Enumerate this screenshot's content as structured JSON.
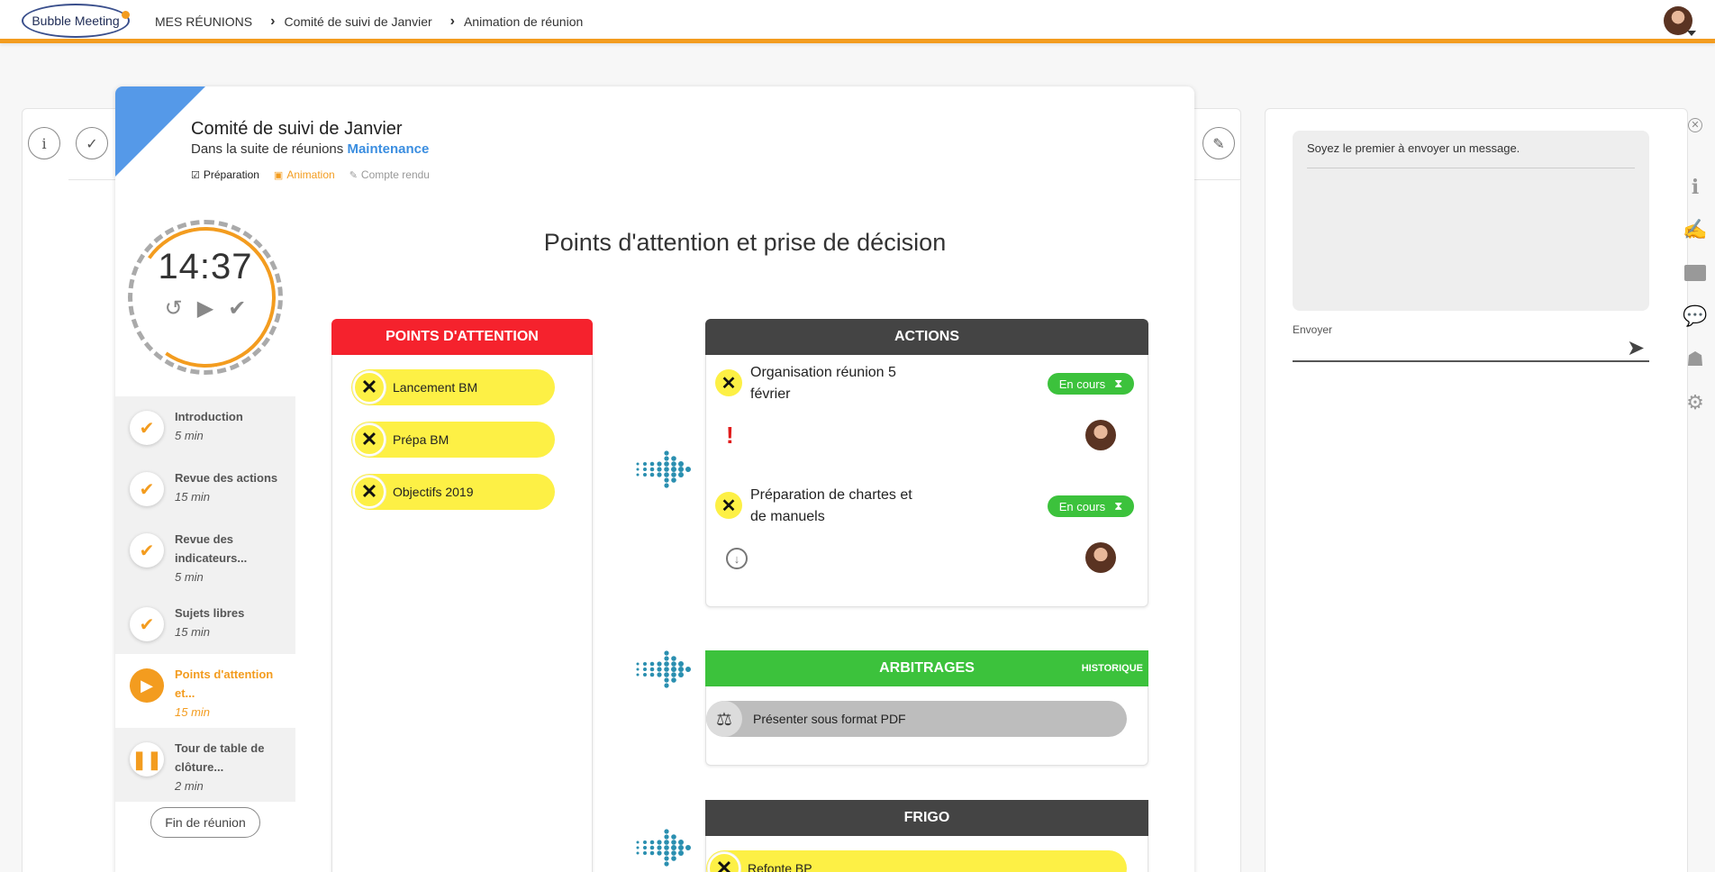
{
  "header": {
    "logo_text": "Bubble Meeting",
    "breadcrumbs": [
      "MES RÉUNIONS",
      "Comité de suivi de Janvier",
      "Animation de réunion"
    ]
  },
  "meeting": {
    "title": "Comité de suivi de Janvier",
    "subtitle_prefix": "Dans la suite de réunions",
    "series_link": "Maintenance",
    "phases": {
      "preparation": "Préparation",
      "animation": "Animation",
      "report": "Compte rendu"
    }
  },
  "timer": {
    "time": "14:37"
  },
  "agenda": [
    {
      "label": "Introduction",
      "duration": "5 min",
      "state": "done"
    },
    {
      "label": "Revue des actions",
      "duration": "15 min",
      "state": "done"
    },
    {
      "label": "Revue des indicateurs...",
      "duration": "5 min",
      "state": "done"
    },
    {
      "label": "Sujets libres",
      "duration": "15 min",
      "state": "done"
    },
    {
      "label": "Points d'attention et...",
      "duration": "15 min",
      "state": "current"
    },
    {
      "label": "Tour de table de clôture...",
      "duration": "2 min",
      "state": "paused"
    }
  ],
  "end_button": "Fin de réunion",
  "step_title": "Points d'attention et prise de décision",
  "attention": {
    "header": "POINTS D'ATTENTION",
    "items": [
      "Lancement BM",
      "Prépa BM",
      "Objectifs 2019"
    ]
  },
  "actions": {
    "header": "ACTIONS",
    "items": [
      {
        "title_line1": "Organisation réunion 5",
        "title_line2": "février",
        "status": "En cours"
      },
      {
        "title_line1": "Préparation de chartes et",
        "title_line2": "de manuels",
        "status": "En cours"
      }
    ]
  },
  "arbitrages": {
    "header": "ARBITRAGES",
    "history_link": "HISTORIQUE",
    "items": [
      "Présenter sous format PDF"
    ]
  },
  "frigo": {
    "header": "FRIGO",
    "items": [
      "Refonte BP"
    ]
  },
  "chat": {
    "empty_message": "Soyez le premier à envoyer un message.",
    "input_label": "Envoyer",
    "input_value": ""
  },
  "colors": {
    "accent": "#f39c1f",
    "attention_red": "#f5222d",
    "actions_dark": "#444444",
    "arbitrage_green": "#3cc23c",
    "pill_yellow": "#fdf045",
    "corner_blue": "#5599e8"
  },
  "icons": {
    "sidebar": [
      "info-icon",
      "signature-icon",
      "folder-icon",
      "chat-icon",
      "team-icon",
      "gear-icon"
    ]
  }
}
